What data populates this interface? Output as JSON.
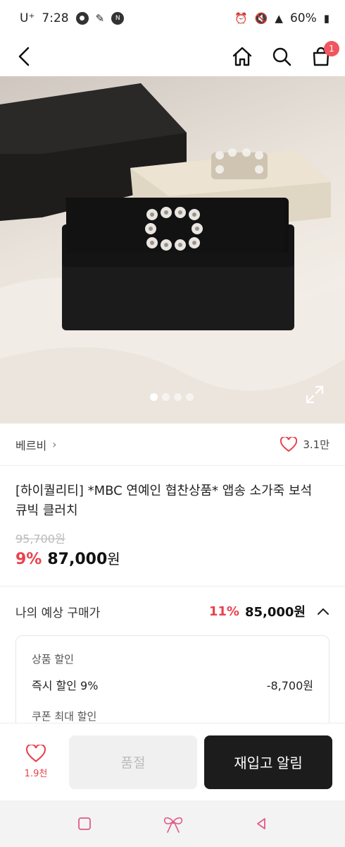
{
  "status_bar": {
    "carrier": "U⁺",
    "time": "7:28",
    "battery": "60%"
  },
  "brand": {
    "name": "베르비",
    "likes": "3.1만"
  },
  "product": {
    "title": "[하이퀄리티] *MBC 연예인 협찬상품* 앱송 소가죽 보석 큐빅 클러치",
    "original_price": "95,700원",
    "discount": "9%",
    "price": "87,000",
    "currency": "원"
  },
  "estimate": {
    "label": "나의 예상 구매가",
    "discount": "11%",
    "price": "85,000원"
  },
  "discount_card": {
    "section1": "상품 할인",
    "line1_label": "즉시 할인 9%",
    "line1_value": "-8,700원",
    "section2": "쿠폰 최대 할인"
  },
  "action_bar": {
    "wish_count": "1.9천",
    "soldout_label": "품절",
    "restock_label": "재입고 알림"
  },
  "cart": {
    "count": "1"
  },
  "gallery": {
    "total": 4,
    "active": 1
  },
  "colors": {
    "accent": "#e8424d",
    "badge": "#f05660",
    "dark_button": "#1c1c1c"
  }
}
